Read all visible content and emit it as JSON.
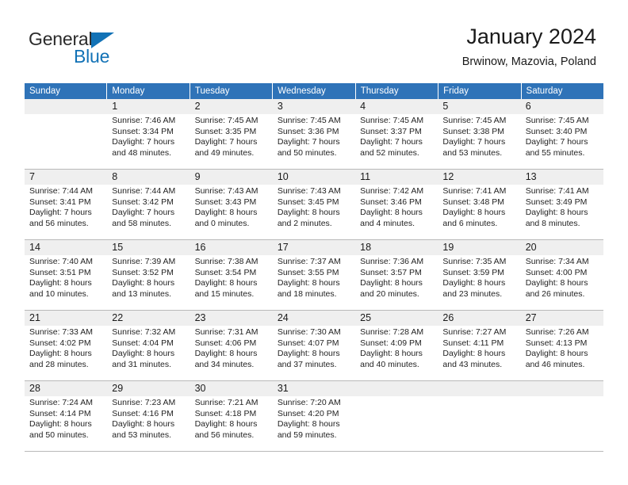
{
  "logo": {
    "text_primary": "General",
    "text_secondary": "Blue",
    "triangle_color": "#1272b6",
    "primary_color": "#2b2b2b"
  },
  "header": {
    "title": "January 2024",
    "subtitle": "Brwinow, Mazovia, Poland"
  },
  "theme": {
    "header_bg": "#2f73b8",
    "header_text": "#ffffff",
    "daynum_bg": "#efefef",
    "grid_line": "#b9b9b9"
  },
  "weekdays": [
    "Sunday",
    "Monday",
    "Tuesday",
    "Wednesday",
    "Thursday",
    "Friday",
    "Saturday"
  ],
  "weeks": [
    {
      "days": [
        {
          "num": "",
          "sunrise": "",
          "sunset": "",
          "daylight_1": "",
          "daylight_2": ""
        },
        {
          "num": "1",
          "sunrise": "Sunrise: 7:46 AM",
          "sunset": "Sunset: 3:34 PM",
          "daylight_1": "Daylight: 7 hours",
          "daylight_2": "and 48 minutes."
        },
        {
          "num": "2",
          "sunrise": "Sunrise: 7:45 AM",
          "sunset": "Sunset: 3:35 PM",
          "daylight_1": "Daylight: 7 hours",
          "daylight_2": "and 49 minutes."
        },
        {
          "num": "3",
          "sunrise": "Sunrise: 7:45 AM",
          "sunset": "Sunset: 3:36 PM",
          "daylight_1": "Daylight: 7 hours",
          "daylight_2": "and 50 minutes."
        },
        {
          "num": "4",
          "sunrise": "Sunrise: 7:45 AM",
          "sunset": "Sunset: 3:37 PM",
          "daylight_1": "Daylight: 7 hours",
          "daylight_2": "and 52 minutes."
        },
        {
          "num": "5",
          "sunrise": "Sunrise: 7:45 AM",
          "sunset": "Sunset: 3:38 PM",
          "daylight_1": "Daylight: 7 hours",
          "daylight_2": "and 53 minutes."
        },
        {
          "num": "6",
          "sunrise": "Sunrise: 7:45 AM",
          "sunset": "Sunset: 3:40 PM",
          "daylight_1": "Daylight: 7 hours",
          "daylight_2": "and 55 minutes."
        }
      ]
    },
    {
      "days": [
        {
          "num": "7",
          "sunrise": "Sunrise: 7:44 AM",
          "sunset": "Sunset: 3:41 PM",
          "daylight_1": "Daylight: 7 hours",
          "daylight_2": "and 56 minutes."
        },
        {
          "num": "8",
          "sunrise": "Sunrise: 7:44 AM",
          "sunset": "Sunset: 3:42 PM",
          "daylight_1": "Daylight: 7 hours",
          "daylight_2": "and 58 minutes."
        },
        {
          "num": "9",
          "sunrise": "Sunrise: 7:43 AM",
          "sunset": "Sunset: 3:43 PM",
          "daylight_1": "Daylight: 8 hours",
          "daylight_2": "and 0 minutes."
        },
        {
          "num": "10",
          "sunrise": "Sunrise: 7:43 AM",
          "sunset": "Sunset: 3:45 PM",
          "daylight_1": "Daylight: 8 hours",
          "daylight_2": "and 2 minutes."
        },
        {
          "num": "11",
          "sunrise": "Sunrise: 7:42 AM",
          "sunset": "Sunset: 3:46 PM",
          "daylight_1": "Daylight: 8 hours",
          "daylight_2": "and 4 minutes."
        },
        {
          "num": "12",
          "sunrise": "Sunrise: 7:41 AM",
          "sunset": "Sunset: 3:48 PM",
          "daylight_1": "Daylight: 8 hours",
          "daylight_2": "and 6 minutes."
        },
        {
          "num": "13",
          "sunrise": "Sunrise: 7:41 AM",
          "sunset": "Sunset: 3:49 PM",
          "daylight_1": "Daylight: 8 hours",
          "daylight_2": "and 8 minutes."
        }
      ]
    },
    {
      "days": [
        {
          "num": "14",
          "sunrise": "Sunrise: 7:40 AM",
          "sunset": "Sunset: 3:51 PM",
          "daylight_1": "Daylight: 8 hours",
          "daylight_2": "and 10 minutes."
        },
        {
          "num": "15",
          "sunrise": "Sunrise: 7:39 AM",
          "sunset": "Sunset: 3:52 PM",
          "daylight_1": "Daylight: 8 hours",
          "daylight_2": "and 13 minutes."
        },
        {
          "num": "16",
          "sunrise": "Sunrise: 7:38 AM",
          "sunset": "Sunset: 3:54 PM",
          "daylight_1": "Daylight: 8 hours",
          "daylight_2": "and 15 minutes."
        },
        {
          "num": "17",
          "sunrise": "Sunrise: 7:37 AM",
          "sunset": "Sunset: 3:55 PM",
          "daylight_1": "Daylight: 8 hours",
          "daylight_2": "and 18 minutes."
        },
        {
          "num": "18",
          "sunrise": "Sunrise: 7:36 AM",
          "sunset": "Sunset: 3:57 PM",
          "daylight_1": "Daylight: 8 hours",
          "daylight_2": "and 20 minutes."
        },
        {
          "num": "19",
          "sunrise": "Sunrise: 7:35 AM",
          "sunset": "Sunset: 3:59 PM",
          "daylight_1": "Daylight: 8 hours",
          "daylight_2": "and 23 minutes."
        },
        {
          "num": "20",
          "sunrise": "Sunrise: 7:34 AM",
          "sunset": "Sunset: 4:00 PM",
          "daylight_1": "Daylight: 8 hours",
          "daylight_2": "and 26 minutes."
        }
      ]
    },
    {
      "days": [
        {
          "num": "21",
          "sunrise": "Sunrise: 7:33 AM",
          "sunset": "Sunset: 4:02 PM",
          "daylight_1": "Daylight: 8 hours",
          "daylight_2": "and 28 minutes."
        },
        {
          "num": "22",
          "sunrise": "Sunrise: 7:32 AM",
          "sunset": "Sunset: 4:04 PM",
          "daylight_1": "Daylight: 8 hours",
          "daylight_2": "and 31 minutes."
        },
        {
          "num": "23",
          "sunrise": "Sunrise: 7:31 AM",
          "sunset": "Sunset: 4:06 PM",
          "daylight_1": "Daylight: 8 hours",
          "daylight_2": "and 34 minutes."
        },
        {
          "num": "24",
          "sunrise": "Sunrise: 7:30 AM",
          "sunset": "Sunset: 4:07 PM",
          "daylight_1": "Daylight: 8 hours",
          "daylight_2": "and 37 minutes."
        },
        {
          "num": "25",
          "sunrise": "Sunrise: 7:28 AM",
          "sunset": "Sunset: 4:09 PM",
          "daylight_1": "Daylight: 8 hours",
          "daylight_2": "and 40 minutes."
        },
        {
          "num": "26",
          "sunrise": "Sunrise: 7:27 AM",
          "sunset": "Sunset: 4:11 PM",
          "daylight_1": "Daylight: 8 hours",
          "daylight_2": "and 43 minutes."
        },
        {
          "num": "27",
          "sunrise": "Sunrise: 7:26 AM",
          "sunset": "Sunset: 4:13 PM",
          "daylight_1": "Daylight: 8 hours",
          "daylight_2": "and 46 minutes."
        }
      ]
    },
    {
      "days": [
        {
          "num": "28",
          "sunrise": "Sunrise: 7:24 AM",
          "sunset": "Sunset: 4:14 PM",
          "daylight_1": "Daylight: 8 hours",
          "daylight_2": "and 50 minutes."
        },
        {
          "num": "29",
          "sunrise": "Sunrise: 7:23 AM",
          "sunset": "Sunset: 4:16 PM",
          "daylight_1": "Daylight: 8 hours",
          "daylight_2": "and 53 minutes."
        },
        {
          "num": "30",
          "sunrise": "Sunrise: 7:21 AM",
          "sunset": "Sunset: 4:18 PM",
          "daylight_1": "Daylight: 8 hours",
          "daylight_2": "and 56 minutes."
        },
        {
          "num": "31",
          "sunrise": "Sunrise: 7:20 AM",
          "sunset": "Sunset: 4:20 PM",
          "daylight_1": "Daylight: 8 hours",
          "daylight_2": "and 59 minutes."
        },
        {
          "num": "",
          "sunrise": "",
          "sunset": "",
          "daylight_1": "",
          "daylight_2": ""
        },
        {
          "num": "",
          "sunrise": "",
          "sunset": "",
          "daylight_1": "",
          "daylight_2": ""
        },
        {
          "num": "",
          "sunrise": "",
          "sunset": "",
          "daylight_1": "",
          "daylight_2": ""
        }
      ]
    }
  ]
}
